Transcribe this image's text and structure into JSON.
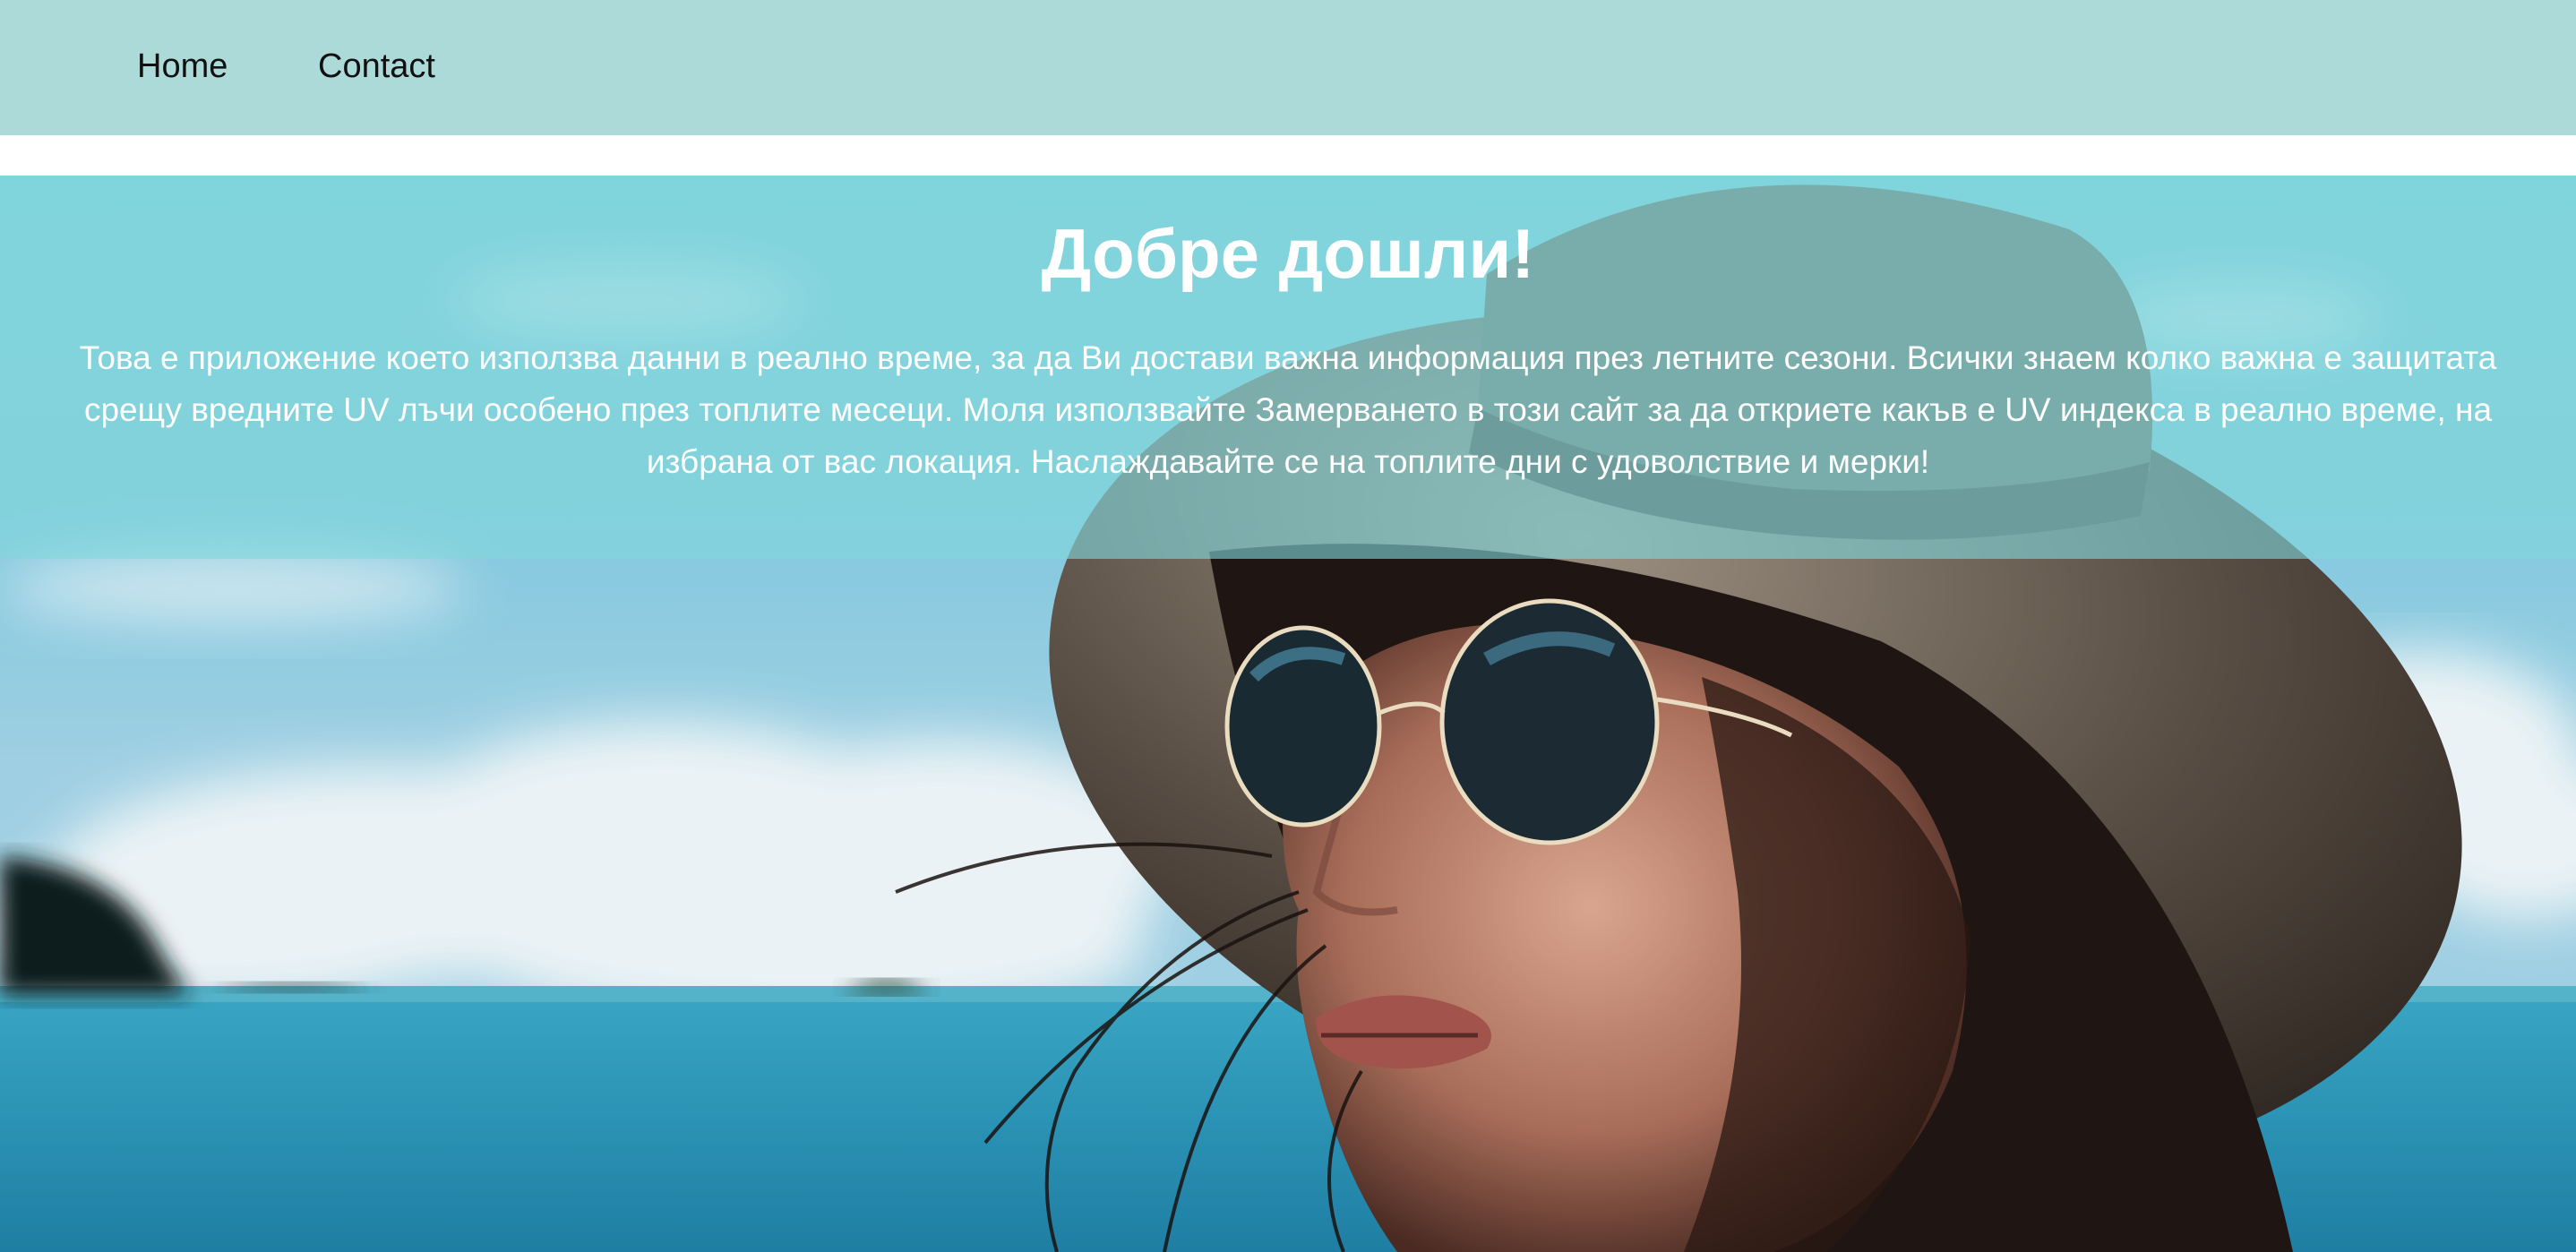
{
  "nav": {
    "items": [
      {
        "label": "Home"
      },
      {
        "label": "Contact"
      }
    ]
  },
  "hero": {
    "title": "Добре дошли!",
    "text": "Това е приложение което използва данни в реално време, за да Ви достави важна информация през летните сезони. Всички знаем колко важна е защитата срещу вредните UV лъчи особено през топлите месеци. Моля използвайте Замерването в този сайт за да откриете какъв е UV индекса в реално време, на избрана от вас локация. Наслаждавайте се на топлите дни с удоволствие и мерки!"
  },
  "colors": {
    "nav_background": "#acdad8",
    "overlay": "#81d7db",
    "text_light": "#ffffff",
    "text_dark": "#111111"
  }
}
